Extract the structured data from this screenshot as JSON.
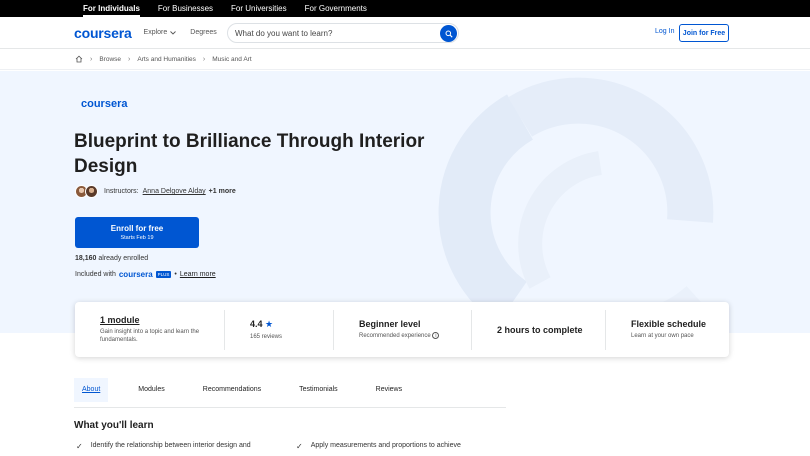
{
  "topbar": {
    "items": [
      "For Individuals",
      "For Businesses",
      "For Universities",
      "For Governments"
    ]
  },
  "header": {
    "logo": "coursera",
    "explore": "Explore",
    "degrees": "Degrees",
    "search_placeholder": "What do you want to learn?",
    "login": "Log In",
    "join": "Join for Free"
  },
  "breadcrumb": [
    "Browse",
    "Arts and Humanities",
    "Music and Art"
  ],
  "hero": {
    "partner_logo": "coursera",
    "title": "Blueprint to Brilliance Through Interior Design",
    "instructors_label": "Instructors:",
    "instructor_name": "Anna Delgove Alday",
    "instructor_more": "+1 more",
    "enroll_label": "Enroll for free",
    "enroll_sub": "Starts Feb 19",
    "enrolled_count": "18,160",
    "enrolled_text": "already enrolled",
    "included_text": "Included with",
    "included_brand": "coursera",
    "included_plus": "PLUS",
    "learn_more": "Learn more"
  },
  "info": {
    "module_title": "1 module",
    "module_desc": "Gain insight into a topic and learn the fundamentals.",
    "rating": "4.4",
    "reviews": "165 reviews",
    "level": "Beginner level",
    "level_sub": "Recommended experience",
    "duration": "2 hours to complete",
    "schedule": "Flexible schedule",
    "schedule_sub": "Learn at your own pace"
  },
  "tabs": [
    "About",
    "Modules",
    "Recommendations",
    "Testimonials",
    "Reviews"
  ],
  "learn": {
    "heading": "What you'll learn",
    "points": [
      "Identify the relationship between interior design and",
      "Apply measurements and proportions to achieve"
    ]
  },
  "colors": {
    "brand": "#0056d2",
    "hero_bg": "#f0f6ff"
  }
}
